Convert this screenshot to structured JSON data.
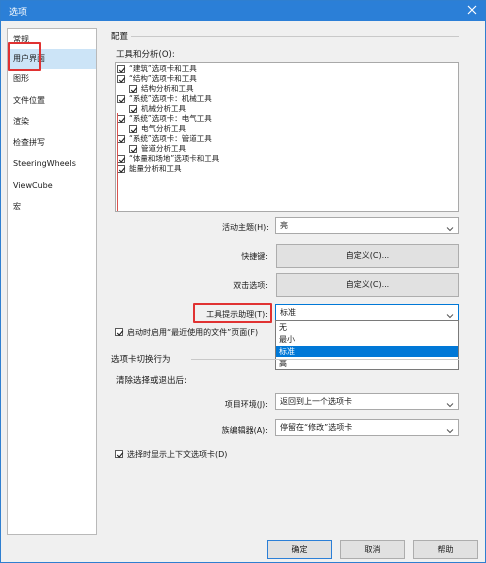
{
  "window": {
    "title": "选项"
  },
  "nav": {
    "items": [
      "常规",
      "用户界面",
      "图形",
      "文件位置",
      "渲染",
      "检查拼写",
      "SteeringWheels",
      "ViewCube",
      "宏"
    ],
    "selected_index": 1
  },
  "config": {
    "heading": "配置",
    "tools_label": "工具和分析(O):",
    "tree": [
      {
        "label": "“建筑”选项卡和工具",
        "checked": true,
        "indent": 0
      },
      {
        "label": "“结构”选项卡和工具",
        "checked": true,
        "indent": 0
      },
      {
        "label": "结构分析和工具",
        "checked": true,
        "indent": 1
      },
      {
        "label": "“系统”选项卡：机械工具",
        "checked": true,
        "indent": 0
      },
      {
        "label": "机械分析工具",
        "checked": true,
        "indent": 1
      },
      {
        "label": "“系统”选项卡：电气工具",
        "checked": true,
        "indent": 0
      },
      {
        "label": "电气分析工具",
        "checked": true,
        "indent": 1
      },
      {
        "label": "“系统”选项卡：管道工具",
        "checked": true,
        "indent": 0
      },
      {
        "label": "管道分析工具",
        "checked": true,
        "indent": 1
      },
      {
        "label": "“体量和场地”选项卡和工具",
        "checked": true,
        "indent": 0
      },
      {
        "label": "能量分析和工具",
        "checked": true,
        "indent": 0
      }
    ]
  },
  "theme": {
    "label": "活动主题(H):",
    "value": "亮"
  },
  "shortcuts": {
    "label": "快捷键:",
    "button": "自定义(C)..."
  },
  "doubleclick": {
    "label": "双击选项:",
    "button": "自定义(C)..."
  },
  "tooltip": {
    "label": "工具提示助理(T):",
    "value": "标准",
    "options": [
      "无",
      "最小",
      "标准",
      "高"
    ],
    "selected_index": 2
  },
  "recent_files": {
    "label": "启动时启用“最近使用的文件”页面(F)",
    "checked": true
  },
  "tab_switch": {
    "heading": "选项卡切换行为",
    "clear_label": "清除选择或退出后:",
    "project_label": "项目环境(J):",
    "project_value": "返回到上一个选项卡",
    "family_label": "族编辑器(A):",
    "family_value": "停留在“修改”选项卡",
    "context_label": "选择时显示上下文选项卡(D)",
    "context_checked": true
  },
  "footer": {
    "ok": "确定",
    "cancel": "取消",
    "help": "帮助"
  },
  "colors": {
    "accent": "#2b7fd7",
    "highlight": "#e03232",
    "selected": "#0078d7"
  }
}
